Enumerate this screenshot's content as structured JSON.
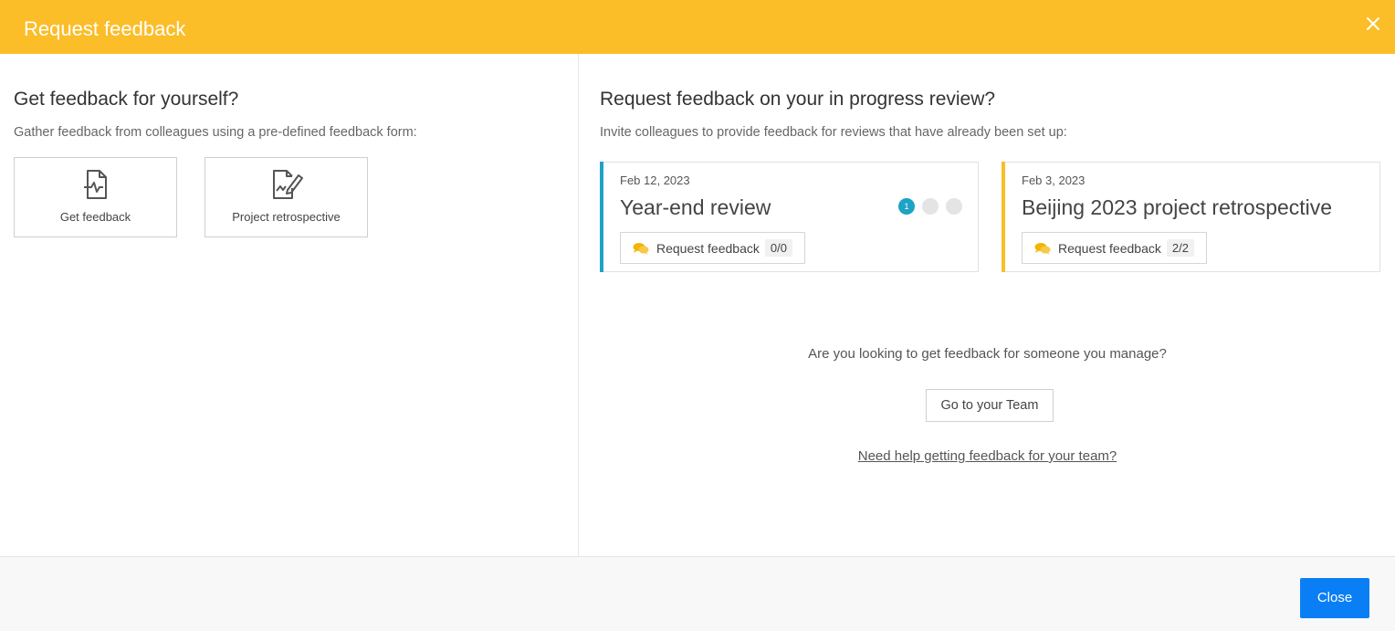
{
  "header": {
    "title": "Request feedback",
    "close_icon": "close-icon"
  },
  "left": {
    "title": "Get feedback for yourself?",
    "subtitle": "Gather feedback from colleagues using a pre-defined feedback form:",
    "tiles": [
      {
        "label": "Get feedback",
        "icon": "feedback-document-icon"
      },
      {
        "label": "Project retrospective",
        "icon": "document-edit-icon"
      }
    ]
  },
  "right": {
    "title": "Request feedback on your in progress review?",
    "subtitle": "Invite colleagues to provide feedback for reviews that have already been set up:",
    "reviews": [
      {
        "date": "Feb 12, 2023",
        "title": "Year-end review",
        "button_label": "Request feedback",
        "count": "0/0",
        "accent": "#1ea2c6",
        "active_step": "1",
        "steps_total": 3
      },
      {
        "date": "Feb 3, 2023",
        "title": "Beijing 2023 project retrospective",
        "button_label": "Request feedback",
        "count": "2/2",
        "accent": "#fbbd28"
      }
    ],
    "manage_question": "Are you looking to get feedback for someone you manage?",
    "team_button": "Go to your Team",
    "help_link": "Need help getting feedback for your team?"
  },
  "footer": {
    "close_label": "Close"
  },
  "colors": {
    "header": "#fbbd28",
    "primary": "#0a7ef5",
    "step_active": "#1ea2c6",
    "chat_icon": "#f4b400"
  }
}
